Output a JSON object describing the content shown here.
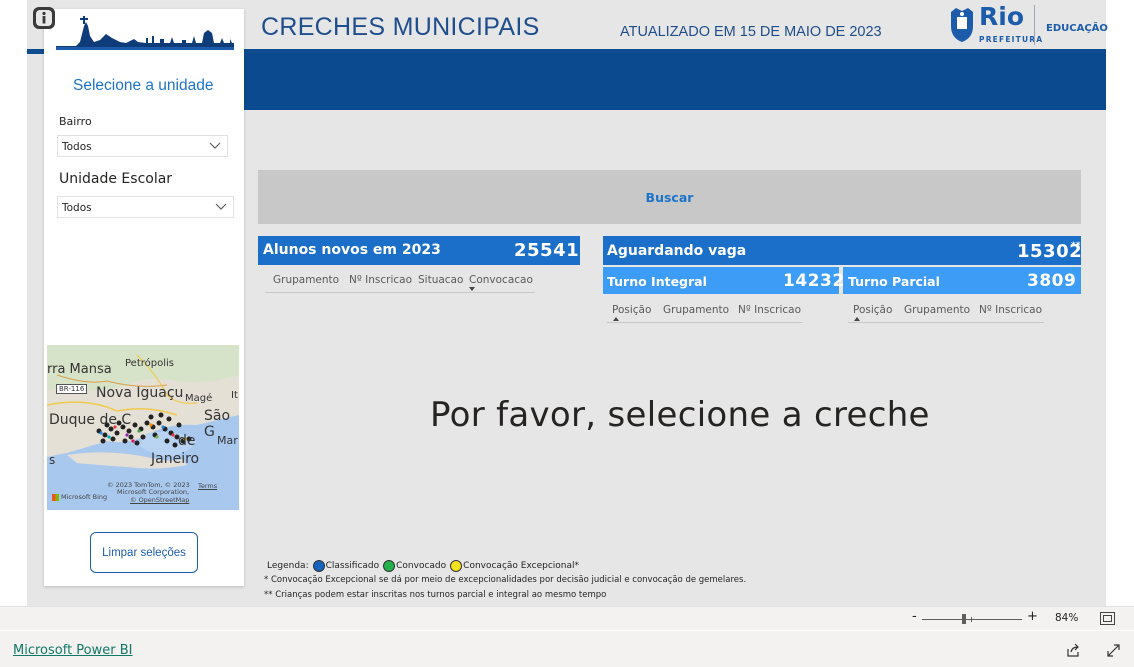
{
  "header": {
    "title": "CRECHES MUNICIPAIS",
    "updated": "ATUALIZADO EM 15 DE MAIO DE 2023",
    "logo_word": "Rio",
    "logo_sub": "PREFEITURA",
    "logo_dept": "EDUCAÇÃO"
  },
  "filters": {
    "heading": "Selecione a unidade",
    "bairro_label": "Bairro",
    "bairro_value": "Todos",
    "unidade_label": "Unidade Escolar",
    "unidade_value": "Todos",
    "clear_button": "Limpar seleções"
  },
  "map": {
    "labels": [
      "rra Mansa",
      "Petrópolis",
      "BR-116",
      "Nova Iguaçu",
      "Magé",
      "It",
      "Duque de C",
      "São G",
      "de",
      "Mar",
      "s",
      "Janeiro"
    ],
    "attribution_1": "© 2023 TomTom, © 2023",
    "attribution_2": "Microsoft Corporation,",
    "attribution_3": "© OpenStreetMap",
    "terms": "Terms",
    "bing": "Microsoft Bing"
  },
  "search": {
    "label": "Buscar"
  },
  "alunos": {
    "title": "Alunos novos em 2023",
    "value": "25541",
    "columns": [
      "Grupamento",
      "Nº Inscricao",
      "Situacao",
      "Convocacao"
    ]
  },
  "aguardando": {
    "title": "Aguardando vaga",
    "value": "15302",
    "mark": "**",
    "integral": {
      "title": "Turno Integral",
      "value": "14232",
      "columns": [
        "Posição",
        "Grupamento",
        "Nº Inscricao"
      ]
    },
    "parcial": {
      "title": "Turno Parcial",
      "value": "3809",
      "columns": [
        "Posição",
        "Grupamento",
        "Nº Inscricao"
      ]
    }
  },
  "message": "Por favor, selecione a creche",
  "legend": {
    "prefix": "Legenda:",
    "items": [
      {
        "label": "Classificado",
        "color": "#1565c0"
      },
      {
        "label": "Convocado",
        "color": "#22b14c"
      },
      {
        "label": "Convocação Excepcional*",
        "color": "#f7e11b"
      }
    ],
    "note1": "* Convocação Excepcional se dá por meio de excepcionalidades por decisão  judicial e convocação de gemelares.",
    "note2": "** Crianças podem estar inscritas nos turnos parcial e integral ao mesmo tempo"
  },
  "zoom": {
    "minus": "-",
    "plus": "+",
    "value": "84%",
    "level": 0.42
  },
  "footer": {
    "link": "Microsoft Power BI"
  },
  "colors": {
    "primary": "#0b4a8e",
    "card": "#1c6fc9",
    "card_light": "#3d9cf5",
    "accent_text": "#1c74c8"
  }
}
